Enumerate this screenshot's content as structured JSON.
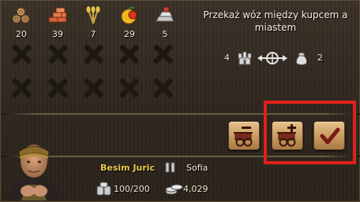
{
  "goods": [
    {
      "icon": "wood-logs-icon",
      "quantity": "20"
    },
    {
      "icon": "bricks-icon",
      "quantity": "39"
    },
    {
      "icon": "wheat-icon",
      "quantity": "7"
    },
    {
      "icon": "fruit-icon",
      "quantity": "29"
    },
    {
      "icon": "iron-ingots-icon",
      "quantity": "5"
    }
  ],
  "instruction": "Przekaż wóz między kupcem a miastem",
  "transfer": {
    "city_count": "4",
    "merchant_count": "2"
  },
  "buttons": [
    {
      "icon": "remove-cart-icon"
    },
    {
      "icon": "add-cart-icon"
    },
    {
      "icon": "confirm-check-icon"
    }
  ],
  "merchant": {
    "name": "Besim Juric",
    "city": "Sofia",
    "cargo": "100/200",
    "money": "4,029"
  },
  "colors": {
    "panel": "#2f271f",
    "merchant_name": "#e8c94a",
    "highlight": "#e0201c",
    "button": "#c79a5f"
  }
}
